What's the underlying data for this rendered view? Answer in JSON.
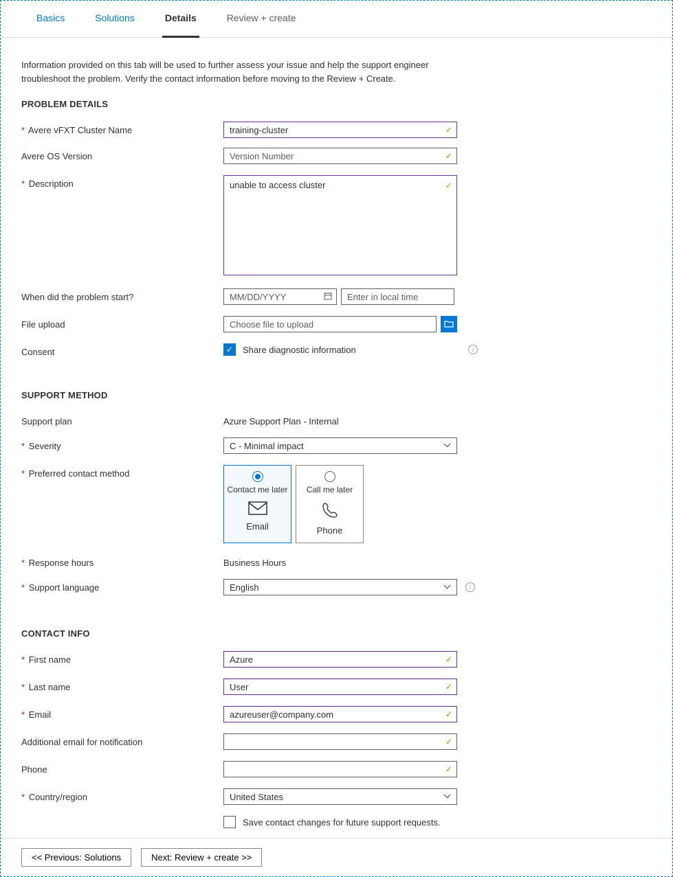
{
  "tabs": {
    "basics": "Basics",
    "solutions": "Solutions",
    "details": "Details",
    "review": "Review + create"
  },
  "intro": "Information provided on this tab will be used to further assess your issue and help the support engineer troubleshoot the problem. Verify the contact information before moving to the Review + Create.",
  "sections": {
    "problem": "PROBLEM DETAILS",
    "support": "SUPPORT METHOD",
    "contact": "CONTACT INFO"
  },
  "labels": {
    "cluster": "Avere vFXT Cluster Name",
    "os": "Avere OS Version",
    "desc": "Description",
    "when": "When did the problem start?",
    "file": "File upload",
    "consent": "Consent",
    "plan": "Support plan",
    "severity": "Severity",
    "method": "Preferred contact method",
    "hours": "Response hours",
    "lang": "Support language",
    "first": "First name",
    "last": "Last name",
    "email": "Email",
    "addl": "Additional email for notification",
    "phone": "Phone",
    "country": "Country/region"
  },
  "values": {
    "cluster": "training-cluster",
    "desc": "unable to access cluster",
    "plan": "Azure Support Plan - Internal",
    "severity": "C - Minimal impact",
    "hours": "Business Hours",
    "lang": "English",
    "first": "Azure",
    "last": "User",
    "email": "azureuser@company.com",
    "country": "United States"
  },
  "placeholders": {
    "os": "Version Number",
    "date": "MM/DD/YYYY",
    "time": "Enter in local time",
    "file": "Choose file to upload"
  },
  "consent": {
    "label": "Share diagnostic information",
    "checked": true
  },
  "contact_cards": {
    "email": {
      "sub": "Contact me later",
      "label": "Email"
    },
    "phone": {
      "sub": "Call me later",
      "label": "Phone"
    }
  },
  "save_checkbox": "Save contact changes for future support requests.",
  "footer": {
    "prev": "<< Previous: Solutions",
    "next": "Next: Review + create >>"
  }
}
